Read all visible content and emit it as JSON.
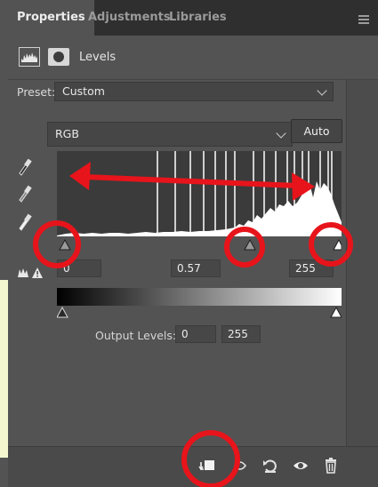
{
  "tabs": [
    {
      "label": "Properties",
      "active": true
    },
    {
      "label": "Adjustments",
      "active": false
    },
    {
      "label": "Libraries",
      "active": false
    }
  ],
  "header": {
    "title": "Levels",
    "icons": [
      "levels-adjustment-icon",
      "layer-mask-icon"
    ]
  },
  "preset": {
    "label": "Preset:",
    "value": "Custom"
  },
  "channel": {
    "value": "RGB"
  },
  "auto_button": "Auto",
  "eyedroppers": [
    "black-point-eyedropper-icon",
    "gray-point-eyedropper-icon",
    "white-point-eyedropper-icon"
  ],
  "input_levels": {
    "black": "0",
    "gamma": "0.57",
    "white": "255"
  },
  "output_levels": {
    "label": "Output Levels:",
    "black": "0",
    "white": "255"
  },
  "footer_icons": [
    "clip-to-layer-icon",
    "view-previous-state-icon",
    "reset-icon",
    "visibility-eye-icon",
    "delete-icon"
  ],
  "colors": {
    "panel_bg": "#535353",
    "tabbar_bg": "#2f2f2f",
    "annotation_red": "#e8141b",
    "histogram_bg": "#3b3b3b"
  }
}
